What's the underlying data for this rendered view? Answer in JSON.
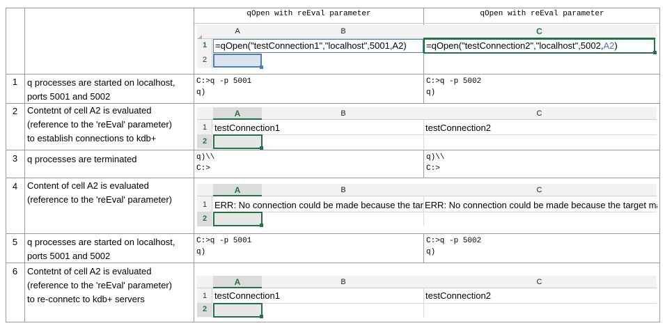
{
  "header": {
    "left_title": "qOpen with reEval parameter",
    "right_title": "qOpen with reEval parameter",
    "cols": [
      "A",
      "B",
      "C"
    ],
    "formula_row1_num": "1",
    "formula_row2_num": "2",
    "formula_a1": "=qOpen(\"testConnection1\",\"localhost\",5001,A2)",
    "formula_c1_prefix": "=qOpen(\"testConnection2\",\"localhost\",5002,",
    "formula_c1_ref": "A2",
    "formula_c1_suffix": ")"
  },
  "steps": [
    {
      "num": "1",
      "lines": [
        "q processes are started on localhost,",
        "ports 5001 and 5002"
      ],
      "console_left": "C:>q -p 5001\nq)",
      "console_right": "C:>q -p 5002\nq)"
    },
    {
      "num": "2",
      "lines": [
        "Contetnt of cell A2 is evaluated",
        "(reference to the 'reEval' parameter)",
        "to establish connections to kdb+"
      ],
      "cell_a1": "testConnection1",
      "cell_c1": "testConnection2"
    },
    {
      "num": "3",
      "lines": [
        "q processes are terminated"
      ],
      "console_left": "q)\\\\\nC:>",
      "console_right": "q)\\\\\nC:>"
    },
    {
      "num": "4",
      "lines": [
        "Content of cell A2 is evaluated",
        "(reference to the 'reEval' parameter)"
      ],
      "cell_a1": "ERR: No connection could be made because the target machine actively refused it.",
      "cell_c1": "ERR: No connection could be made because the target machine actively refused it."
    },
    {
      "num": "5",
      "lines": [
        "q processes are started on localhost,",
        "ports 5001 and 5002"
      ],
      "console_left": "C:>q -p 5001\nq)",
      "console_right": "C:>q -p 5002\nq)"
    },
    {
      "num": "6",
      "lines": [
        "Contetnt of cell A2 is evaluated",
        "(reference to the 'reEval' parameter)",
        "to re-connetc to kdb+ servers"
      ],
      "cell_a1": "testConnection1",
      "cell_c1": "testConnection2"
    }
  ],
  "mini_grid": {
    "cols": [
      "A",
      "B",
      "C"
    ],
    "row1": "1",
    "row2": "2"
  },
  "colors": {
    "accent": "#217346",
    "reference": "#4472c4",
    "border": "#9a9a9a"
  }
}
